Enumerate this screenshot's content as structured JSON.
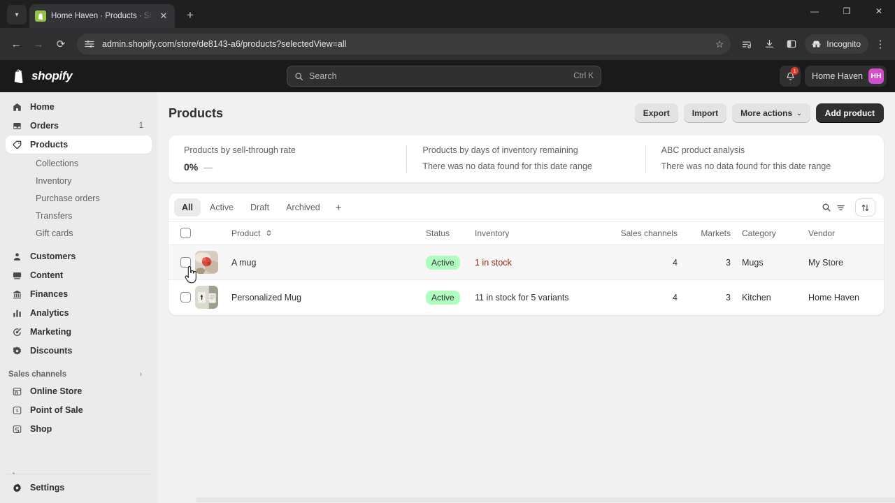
{
  "browser": {
    "tab": {
      "title": "Home Haven · Products · Shopify",
      "favicon": "shopify-bag-icon"
    },
    "new_tab_label": "+",
    "window_controls": {
      "minimize": "—",
      "maximize": "❐",
      "close": "✕"
    },
    "nav": {
      "back": "←",
      "forward": "→",
      "reload": "⟳"
    },
    "url": "admin.shopify.com/store/de8143-a6/products?selectedView=all",
    "profile_label": "Incognito",
    "toolbar_icons": [
      "bookmark-star-icon",
      "reading-list-icon",
      "download-icon",
      "side-panel-icon",
      "incognito-icon",
      "chrome-menu-icon"
    ]
  },
  "topbar": {
    "logo_text": "shopify",
    "search": {
      "placeholder": "Search",
      "shortcut": "Ctrl K"
    },
    "notifications": {
      "count": "1"
    },
    "store": {
      "name": "Home Haven",
      "initials": "HH",
      "avatar_color": "#d34ecd"
    }
  },
  "sidebar": {
    "items": [
      {
        "label": "Home",
        "icon": "home-icon",
        "count": ""
      },
      {
        "label": "Orders",
        "icon": "orders-inbox-icon",
        "count": "1"
      },
      {
        "label": "Products",
        "icon": "products-tag-icon",
        "count": "",
        "active": true
      },
      {
        "label": "Customers",
        "icon": "customers-person-icon",
        "count": ""
      },
      {
        "label": "Content",
        "icon": "content-icon",
        "count": ""
      },
      {
        "label": "Finances",
        "icon": "finances-bank-icon",
        "count": ""
      },
      {
        "label": "Analytics",
        "icon": "analytics-bars-icon",
        "count": ""
      },
      {
        "label": "Marketing",
        "icon": "marketing-target-icon",
        "count": ""
      },
      {
        "label": "Discounts",
        "icon": "discounts-icon",
        "count": ""
      }
    ],
    "product_subitems": [
      "Collections",
      "Inventory",
      "Purchase orders",
      "Transfers",
      "Gift cards"
    ],
    "sales_channels": {
      "label": "Sales channels",
      "chevron": "›",
      "items": [
        {
          "label": "Online Store",
          "icon": "online-store-icon"
        },
        {
          "label": "Point of Sale",
          "icon": "point-of-sale-icon"
        },
        {
          "label": "Shop",
          "icon": "shop-icon"
        }
      ]
    },
    "settings": {
      "label": "Settings",
      "icon": "gear-icon"
    }
  },
  "page": {
    "title": "Products",
    "actions": {
      "export": "Export",
      "import": "Import",
      "more_actions": "More actions",
      "more_actions_chevron": "⌄",
      "add_product": "Add product"
    }
  },
  "cards": [
    {
      "title": "Products by sell-through rate",
      "value": "0%",
      "delta": "—",
      "empty": ""
    },
    {
      "title": "Products by days of inventory remaining",
      "value": "",
      "delta": "",
      "empty": "There was no data found for this date range"
    },
    {
      "title": "ABC product analysis",
      "value": "",
      "delta": "",
      "empty": "There was no data found for this date range"
    }
  ],
  "panel": {
    "tabs": [
      {
        "label": "All",
        "selected": true
      },
      {
        "label": "Active",
        "selected": false
      },
      {
        "label": "Draft",
        "selected": false
      },
      {
        "label": "Archived",
        "selected": false
      }
    ],
    "add_tab": "+",
    "tools": {
      "search_filter": "search-filter-icon",
      "sort": "sort-arrows-icon"
    },
    "columns": [
      "",
      "",
      "Product",
      "Status",
      "Inventory",
      "Sales channels",
      "Markets",
      "Category",
      "Vendor"
    ],
    "product_sort_icon": "sort-chevrons-icon",
    "rows": [
      {
        "selected": false,
        "hovered": true,
        "thumb": "mug-with-flowers-photo",
        "product": "A mug",
        "status": "Active",
        "inventory": "1 in stock",
        "inventory_low": true,
        "sales_channels": "4",
        "markets": "3",
        "category": "Mugs",
        "vendor": "My Store"
      },
      {
        "selected": false,
        "hovered": false,
        "thumb": "personalized-mug-photo",
        "product": "Personalized Mug",
        "status": "Active",
        "inventory": "11 in stock for 5 variants",
        "inventory_low": false,
        "sales_channels": "4",
        "markets": "3",
        "category": "Kitchen",
        "vendor": "Home Haven"
      }
    ]
  },
  "colors": {
    "accent": "#d34ecd",
    "status_active_bg": "#affebf",
    "inventory_low": "#8e1f0b",
    "primary_button": "#303030",
    "notification_badge": "#e03d2f"
  }
}
